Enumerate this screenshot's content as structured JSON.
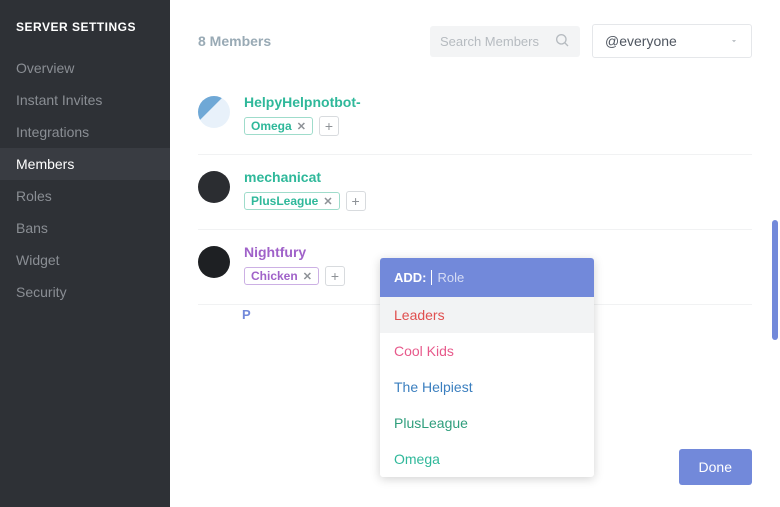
{
  "sidebar": {
    "title": "SERVER SETTINGS",
    "items": [
      {
        "label": "Overview"
      },
      {
        "label": "Instant Invites"
      },
      {
        "label": "Integrations"
      },
      {
        "label": "Members",
        "active": true
      },
      {
        "label": "Roles"
      },
      {
        "label": "Bans"
      },
      {
        "label": "Widget"
      },
      {
        "label": "Security"
      }
    ]
  },
  "topbar": {
    "member_count_label": "8 Members",
    "search_placeholder": "Search Members",
    "role_filter_selected": "@everyone"
  },
  "members": [
    {
      "name": "HelpyHelpnotbot-",
      "name_color": "u-helpy",
      "avatar": "helpy",
      "roles": [
        {
          "label": "Omega",
          "cls": "chip-omega"
        }
      ]
    },
    {
      "name": "mechanicat",
      "name_color": "u-mech",
      "avatar": "mech",
      "roles": [
        {
          "label": "PlusLeague",
          "cls": "chip-plus"
        }
      ]
    },
    {
      "name": "Nightfury",
      "name_color": "u-night",
      "avatar": "night",
      "roles": [
        {
          "label": "Chicken",
          "cls": "chip-chick"
        }
      ]
    }
  ],
  "partial_initial": "P",
  "popover": {
    "add_prefix": "ADD:",
    "placeholder": "Role",
    "options": [
      {
        "label": "Leaders",
        "cls": "c-leaders",
        "selected": true
      },
      {
        "label": "Cool Kids",
        "cls": "c-cool"
      },
      {
        "label": "The Helpiest",
        "cls": "c-help"
      },
      {
        "label": "PlusLeague",
        "cls": "c-plus"
      },
      {
        "label": "Omega",
        "cls": "c-omega"
      }
    ]
  },
  "done_label": "Done"
}
